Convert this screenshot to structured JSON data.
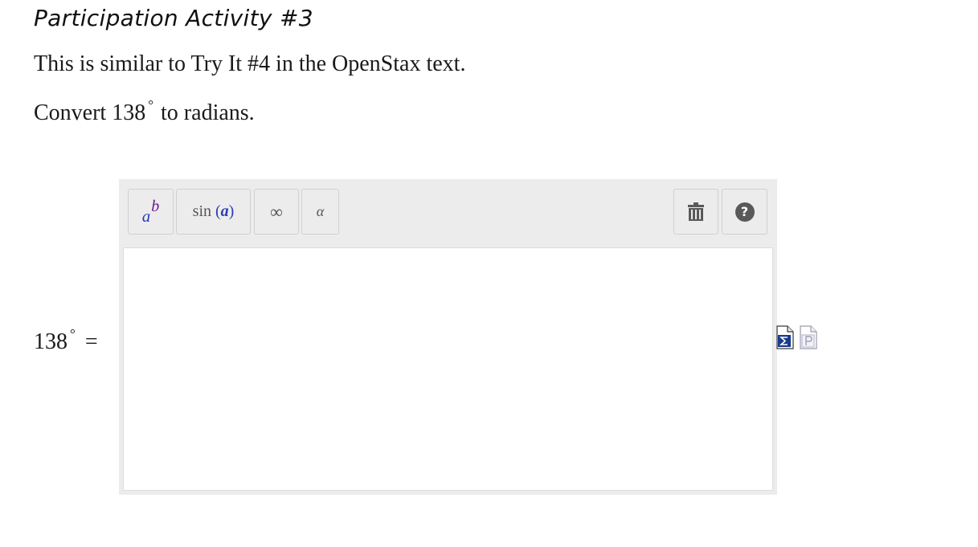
{
  "heading": "Participation Activity #3",
  "intro_text": "This is similar to Try It #4 in the OpenStax text.",
  "prompt": {
    "before": "Convert 138",
    "degree": "°",
    "after": "to radians."
  },
  "equation": {
    "value": "138",
    "degree": "°",
    "equals": "="
  },
  "toolbar": {
    "power_base": "a",
    "power_exp": "b",
    "sin_func": "sin",
    "sin_open": "(",
    "sin_arg": "a",
    "sin_close": ")",
    "infinity": "∞",
    "alpha": "α",
    "help": "?"
  },
  "answer": {
    "value": ""
  },
  "colors": {
    "toolbar_bg": "#ececec",
    "variable_blue": "#2a3fb5",
    "exponent_purple": "#6a1a8a",
    "icon_gray": "#595959"
  }
}
